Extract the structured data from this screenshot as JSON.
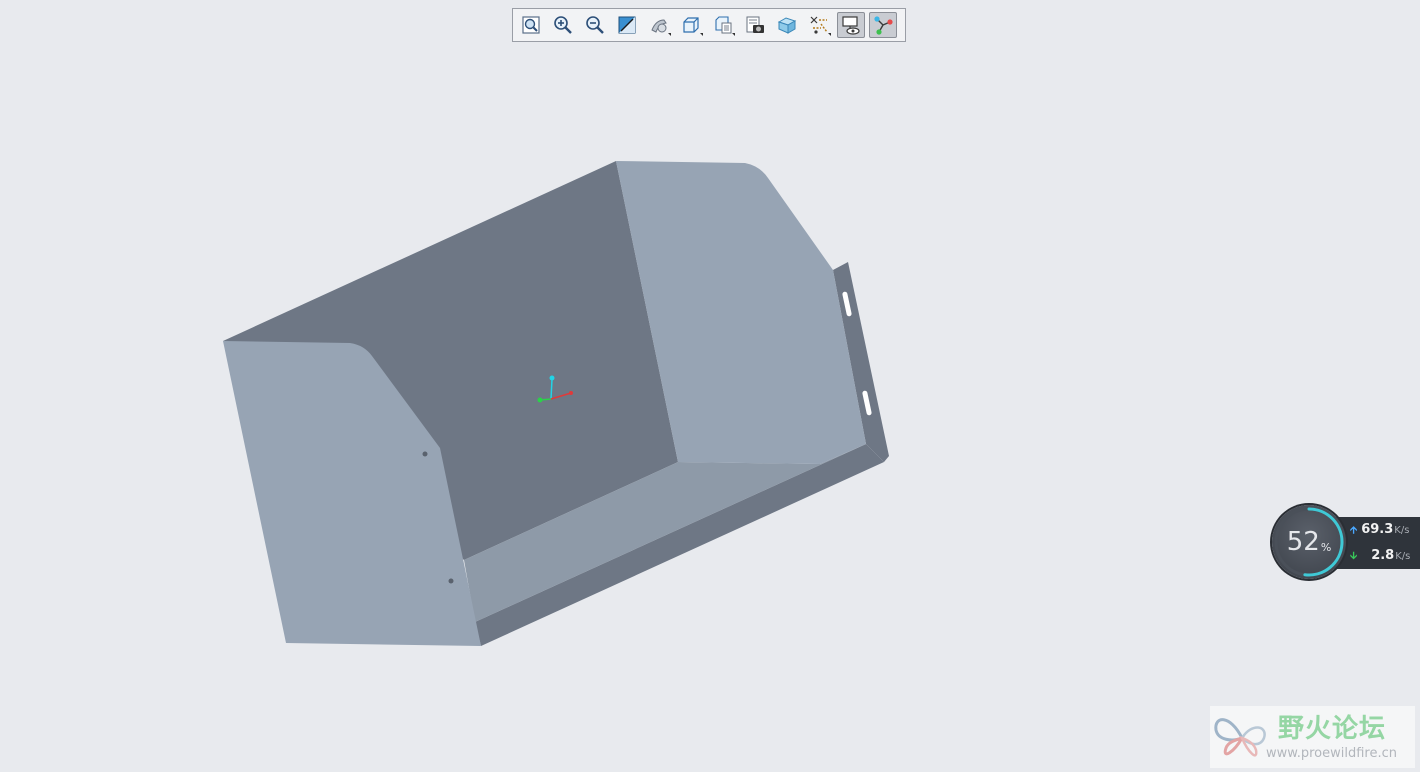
{
  "toolbar": {
    "buttons": [
      {
        "icon": "refit-icon",
        "tooltip": "Refit"
      },
      {
        "icon": "zoom-in-icon",
        "tooltip": "Zoom In"
      },
      {
        "icon": "zoom-out-icon",
        "tooltip": "Zoom Out"
      },
      {
        "icon": "repaint-icon",
        "tooltip": "Repaint"
      },
      {
        "icon": "perspective-icon",
        "tooltip": "Perspective View"
      },
      {
        "icon": "display-style-icon",
        "tooltip": "Display Style"
      },
      {
        "icon": "saved-orientations-icon",
        "tooltip": "Saved Orientations"
      },
      {
        "icon": "view-manager-icon",
        "tooltip": "View Manager"
      },
      {
        "icon": "section-icon",
        "tooltip": "Section"
      },
      {
        "icon": "datum-display-icon",
        "tooltip": "Datum Display Filters"
      },
      {
        "icon": "annotation-display-icon",
        "tooltip": "Annotation Display"
      },
      {
        "icon": "spin-center-icon",
        "tooltip": "Spin Center"
      }
    ],
    "active_buttons": [
      "annotation-display-icon",
      "spin-center-icon"
    ]
  },
  "model": {
    "color_light": "#97a4b4",
    "color_dark": "#6e7785",
    "color_mid": "#8a95a3"
  },
  "csys": {
    "colors": {
      "x": "#e03a3a",
      "y": "#2bd14a",
      "z": "#22d4e6"
    }
  },
  "network_widget": {
    "cpu_percent": "52",
    "percent_unit": "%",
    "percent_value": 52,
    "upload": "69.3",
    "download": "2.8",
    "unit": "K/s"
  },
  "watermark": {
    "title": "野火论坛",
    "url": "www.proewildfire.cn"
  }
}
